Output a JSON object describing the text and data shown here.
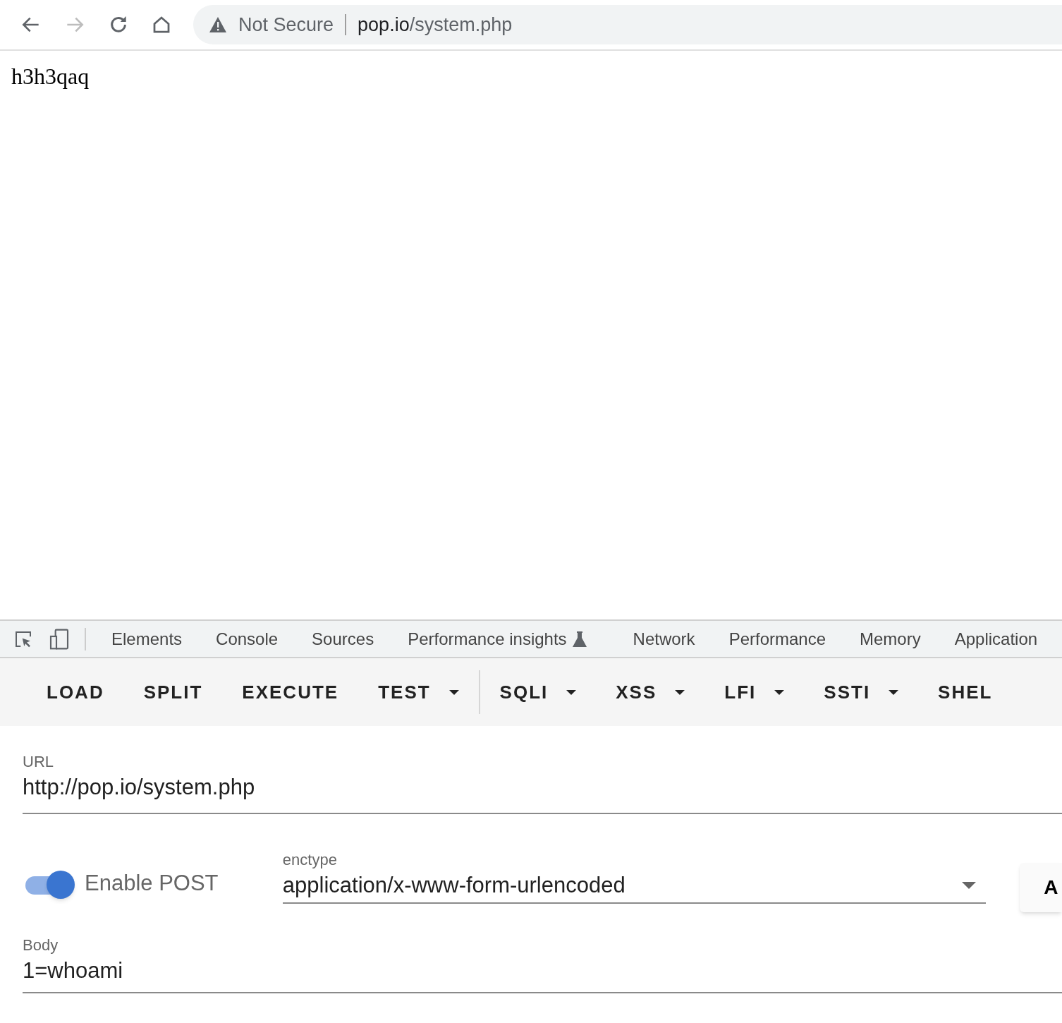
{
  "browser": {
    "security_label": "Not Secure",
    "url_host": "pop.io",
    "url_path": "/system.php"
  },
  "page": {
    "text": "h3h3qaq"
  },
  "devtools_tabs": [
    {
      "label": "Elements",
      "experimental": false
    },
    {
      "label": "Console",
      "experimental": false
    },
    {
      "label": "Sources",
      "experimental": false
    },
    {
      "label": "Performance insights",
      "experimental": true
    },
    {
      "label": "Network",
      "experimental": false
    },
    {
      "label": "Performance",
      "experimental": false
    },
    {
      "label": "Memory",
      "experimental": false
    },
    {
      "label": "Application",
      "experimental": false
    }
  ],
  "hackbar_buttons": [
    {
      "label": "LOAD",
      "dropdown": false,
      "divider_after": false
    },
    {
      "label": "SPLIT",
      "dropdown": false,
      "divider_after": false
    },
    {
      "label": "EXECUTE",
      "dropdown": false,
      "divider_after": false
    },
    {
      "label": "TEST",
      "dropdown": true,
      "divider_after": true
    },
    {
      "label": "SQLI",
      "dropdown": true,
      "divider_after": false
    },
    {
      "label": "XSS",
      "dropdown": true,
      "divider_after": false
    },
    {
      "label": "LFI",
      "dropdown": true,
      "divider_after": false
    },
    {
      "label": "SSTI",
      "dropdown": true,
      "divider_after": false
    },
    {
      "label": "SHEL",
      "dropdown": false,
      "divider_after": false
    }
  ],
  "url_field": {
    "label": "URL",
    "value": "http://pop.io/system.php"
  },
  "post_toggle": {
    "label": "Enable POST",
    "on": true
  },
  "enctype": {
    "label": "enctype",
    "value": "application/x-www-form-urlencoded"
  },
  "side_button": {
    "label": "A"
  },
  "body_field": {
    "label": "Body",
    "value": "1=whoami"
  }
}
